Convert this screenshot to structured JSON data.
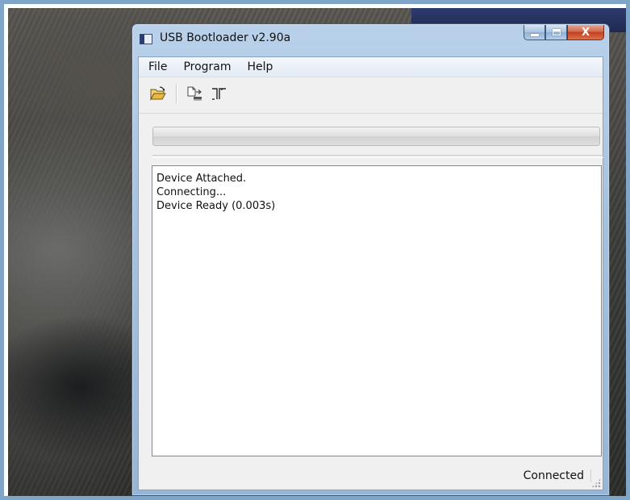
{
  "window": {
    "title": "USB Bootloader v2.90a"
  },
  "caption_buttons": {
    "minimize_icon": "minimize-icon",
    "maximize_icon": "maximize-icon",
    "close_label": "X"
  },
  "menu": {
    "items": [
      "File",
      "Program",
      "Help"
    ]
  },
  "toolbar": {
    "buttons": [
      {
        "icon": "open-folder-icon"
      },
      {
        "icon": "program-device-icon"
      },
      {
        "icon": "reset-device-icon"
      }
    ]
  },
  "progress": {
    "fraction": 0
  },
  "log": {
    "lines": [
      "Device Attached.",
      "Connecting...",
      "Device Ready (0.003s)"
    ]
  },
  "status": {
    "text": "Connected"
  },
  "colors": {
    "title_bar": "#a7c2e0",
    "close_button": "#c3401e",
    "client_bg": "#f0f0f0"
  }
}
